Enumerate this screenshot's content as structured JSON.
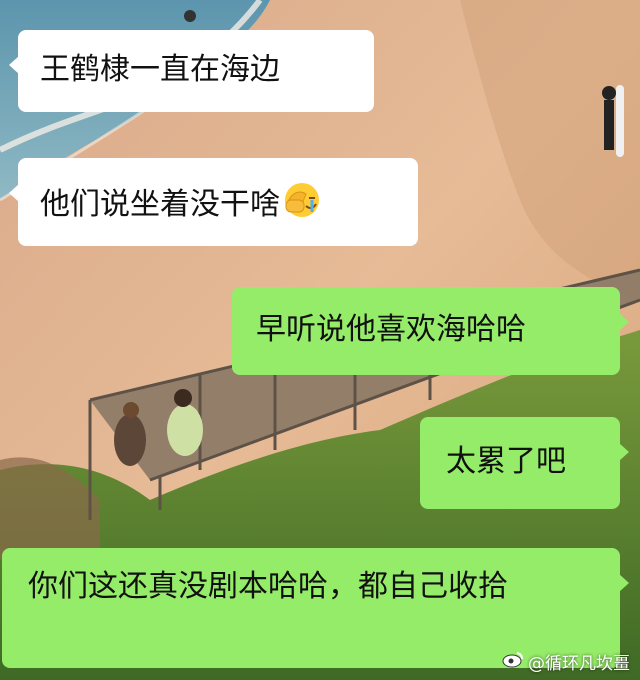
{
  "messages": [
    {
      "side": "in",
      "text": "王鹤棣一直在海边"
    },
    {
      "side": "in",
      "text": "他们说坐着没干啥",
      "emoji": "facepalm-crying-emoji"
    },
    {
      "side": "out",
      "text": "早听说他喜欢海哈哈"
    },
    {
      "side": "out",
      "text": "太累了吧"
    },
    {
      "side": "out",
      "text": "你们这还真没剧本哈哈，都自己收拾"
    }
  ],
  "watermark": {
    "text": "@循环凡坎畺",
    "icon": "weibo-logo-icon"
  },
  "colors": {
    "incoming_bubble": "#ffffff",
    "outgoing_bubble": "#95ec69",
    "sand": "#e2b58f",
    "sea": "#6fa4b8"
  }
}
